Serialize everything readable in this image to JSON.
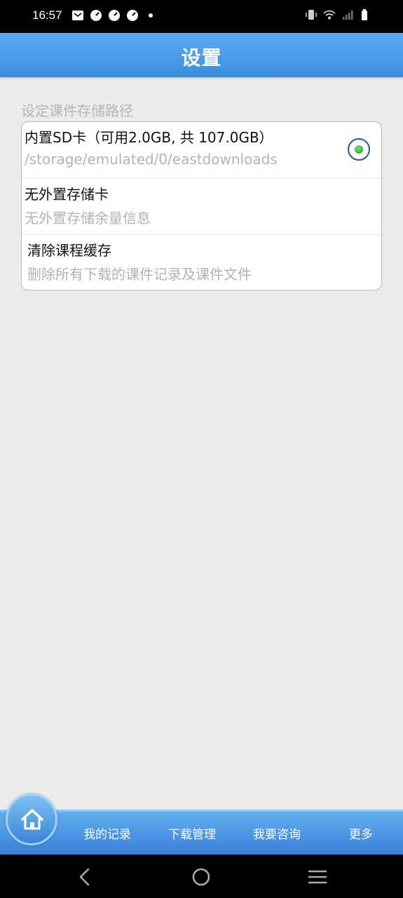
{
  "status_bar": {
    "time": "16:57",
    "left_icons": [
      "mail-icon",
      "gauge-icon",
      "gauge-icon",
      "gauge-icon",
      "dot-icon"
    ],
    "right_icons": [
      "vibrate-icon",
      "wifi-icon",
      "signal-icon",
      "battery-icon"
    ]
  },
  "header": {
    "title": "设置"
  },
  "storage_section": {
    "label": "设定课件存储路径",
    "items": [
      {
        "title": "内置SD卡（可用2.0GB, 共 107.0GB）",
        "subtitle": "/storage/emulated/0/eastdownloads",
        "selected": true
      },
      {
        "title": "无外置存储卡",
        "subtitle": "无外置存储余量信息"
      },
      {
        "title": "清除课程缓存",
        "subtitle": "删除所有下载的课件记录及课件文件"
      }
    ]
  },
  "bottom_nav": {
    "home_icon": "home-icon",
    "items": [
      {
        "label": "我的记录"
      },
      {
        "label": "下载管理"
      },
      {
        "label": "我要咨询"
      },
      {
        "label": "更多"
      }
    ]
  },
  "system_nav": [
    "back-icon",
    "home-circle-icon",
    "menu-icon"
  ],
  "colors": {
    "accent": "#3c8edc",
    "background": "#ebebeb",
    "radio_dot": "#1f9a1f"
  }
}
